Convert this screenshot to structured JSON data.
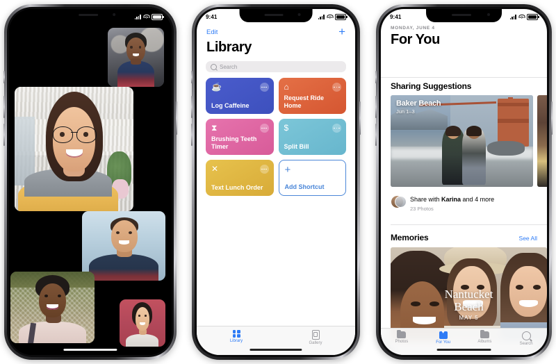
{
  "phones": [
    {
      "id": "facetime",
      "status_bar": {
        "time": "",
        "signal": "signal-icon",
        "wifi": "wifi-icon",
        "battery": "battery-icon"
      },
      "app": "FaceTime Group Call",
      "participants": [
        {
          "name": "participant-1",
          "position": "top-right-small"
        },
        {
          "name": "participant-2",
          "position": "large-center"
        },
        {
          "name": "participant-3",
          "position": "mid-right"
        },
        {
          "name": "participant-4",
          "position": "lower-left"
        },
        {
          "name": "participant-5",
          "position": "bottom-right-small"
        }
      ]
    },
    {
      "id": "shortcuts",
      "status_bar": {
        "time": "9:41",
        "signal": "signal-icon",
        "wifi": "wifi-icon",
        "battery": "battery-icon"
      },
      "nav": {
        "edit_label": "Edit",
        "add_label": "+"
      },
      "title": "Library",
      "search": {
        "placeholder": "Search",
        "icon": "search-icon"
      },
      "tiles": [
        {
          "name": "Log Caffeine",
          "icon": "☕",
          "color_from": "#4558c8",
          "color_to": "#3f53c4",
          "more": "more-icon"
        },
        {
          "name": "Request Ride Home",
          "icon": "⌂",
          "color_from": "#e0663c",
          "color_to": "#da5a34",
          "more": "more-icon"
        },
        {
          "name": "Brushing Teeth Timer",
          "icon": "⧗",
          "color_from": "#e06aa6",
          "color_to": "#dc5e9e",
          "more": "more-icon"
        },
        {
          "name": "Split Bill",
          "icon": "$",
          "color_from": "#73c0d4",
          "color_to": "#6cbbd1",
          "more": "more-icon"
        },
        {
          "name": "Text Lunch Order",
          "icon": "✕",
          "color_from": "#e2bb45",
          "color_to": "#dcb23c",
          "more": "more-icon"
        }
      ],
      "add_tile": {
        "name": "Add Shortcut",
        "icon": "+",
        "color": "#4a86d8"
      },
      "tabs": [
        {
          "label": "Library",
          "icon": "grid-icon",
          "active": true
        },
        {
          "label": "Gallery",
          "icon": "gallery-icon",
          "active": false
        }
      ]
    },
    {
      "id": "photos",
      "status_bar": {
        "time": "9:41",
        "signal": "signal-icon",
        "wifi": "wifi-icon",
        "battery": "battery-icon"
      },
      "date": "MONDAY, JUNE 4",
      "title": "For You",
      "sections": [
        {
          "heading": "Sharing Suggestions",
          "see_all": "",
          "card": {
            "title": "Baker Beach",
            "subtitle": "Jun 1–3"
          },
          "share": {
            "line1_prefix": "Share with ",
            "line1_name": "Karina",
            "line1_suffix": " and 4 more",
            "line2": "23 Photos",
            "avatar": "avatar"
          }
        },
        {
          "heading": "Memories",
          "see_all": "See All",
          "card": {
            "title": "Nantucket Beach",
            "title_line1": "Nantucket",
            "title_line2": "Beach",
            "subtitle": "MAY 5"
          }
        }
      ],
      "tabs": [
        {
          "label": "Photos",
          "icon": "photos-icon",
          "active": false
        },
        {
          "label": "For You",
          "icon": "foryou-icon",
          "active": true
        },
        {
          "label": "Albums",
          "icon": "albums-icon",
          "active": false
        },
        {
          "label": "Search",
          "icon": "search-icon",
          "active": false
        }
      ]
    }
  ]
}
